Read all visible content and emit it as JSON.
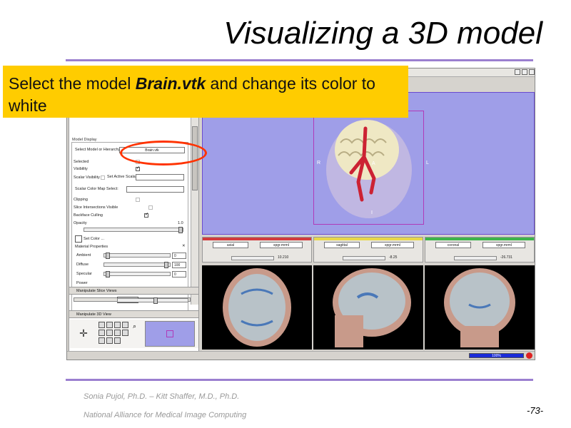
{
  "slide": {
    "title": "Visualizing a 3D model",
    "callout_prefix": "Select the model ",
    "callout_model": "Brain.vtk",
    "callout_suffix": " and change its color to white",
    "footer_line1": "Sonia Pujol, Ph.D. – Kitt Shaffer, M.D., Ph.D.",
    "footer_line2": "National Alliance for Medical Image Computing",
    "page_number": "-73-"
  },
  "colors": {
    "callout_bg": "#ffcc00",
    "accent_rule": "#9b7fd0",
    "highlight_ring": "#ff3300",
    "view3d_bg": "#9f9ee8"
  },
  "model_panel": {
    "frame_label": "Model Display",
    "select_label": "Select Model or Hierarchy:",
    "select_value": "Brain.vtk",
    "selected_label": "Selected",
    "visibility_label": "Visibility",
    "visibility_checked": true,
    "scalar_visibility_label": "Scalar Visibility",
    "set_active_scalar_label": "Set Active Scalar:",
    "scalar_color_map_label": "Scalar Color Map Select:",
    "clipping_label": "Clipping",
    "slice_intersections_label": "Slice Intersections Visible",
    "backface_culling_label": "Backface Culling",
    "backface_culling_checked": true,
    "opacity_label": "Opacity",
    "opacity_value": "1.0",
    "set_color_label": "Set Color ...",
    "material_label": "Material Properties",
    "ambient_label": "Ambient",
    "ambient_value": "0",
    "diffuse_label": "Diffuse",
    "diffuse_value": "100",
    "specular_label": "Specular",
    "specular_value": "0",
    "power_label": "Power"
  },
  "sections": {
    "slice_views": "Manipulate Slice Views",
    "view_3d": "Manipulate 3D View"
  },
  "view3d": {
    "label_right": "R",
    "label_left": "L",
    "label_ant": "A",
    "label_inf": "I"
  },
  "slices": [
    {
      "name": "Axial",
      "color": "#d23b3b",
      "fg": "axial",
      "bg": "spgr.mrml",
      "value": "10.210"
    },
    {
      "name": "Sagittal",
      "color": "#e8d84a",
      "fg": "sagittal",
      "bg": "spgr.mrml",
      "value": "-8.25"
    },
    {
      "name": "Coronal",
      "color": "#3cb44a",
      "fg": "coronal",
      "bg": "spgr.mrml",
      "value": "-26.731"
    }
  ],
  "status": {
    "progress_text": "100%"
  }
}
